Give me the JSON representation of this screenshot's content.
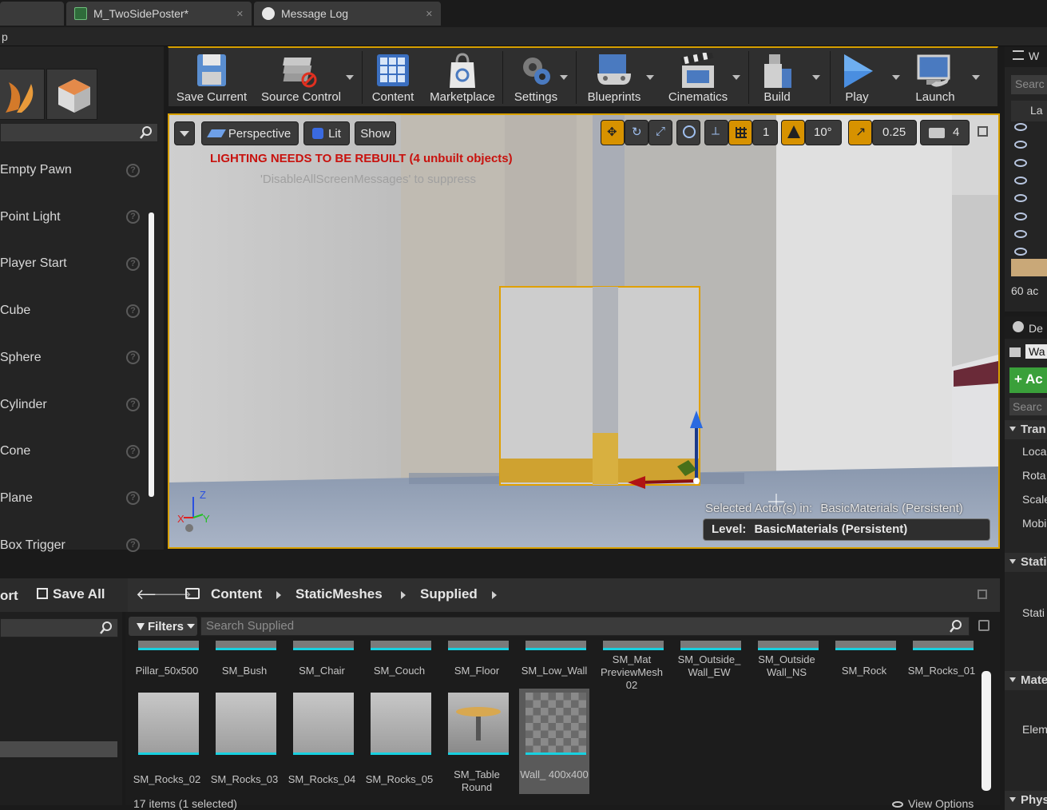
{
  "tabs": [
    {
      "label": "M_TwoSidePoster*"
    },
    {
      "label": "Message Log"
    }
  ],
  "menu": {
    "partial_label": "p"
  },
  "modes": {
    "place_items": [
      {
        "label": "Empty Pawn"
      },
      {
        "label": "Point Light"
      },
      {
        "label": "Player Start"
      },
      {
        "label": "Cube"
      },
      {
        "label": "Sphere"
      },
      {
        "label": "Cylinder"
      },
      {
        "label": "Cone"
      },
      {
        "label": "Plane"
      },
      {
        "label": "Box Trigger"
      }
    ],
    "help_glyph": "?"
  },
  "toolbar": {
    "save_current": "Save Current",
    "source_control": "Source Control",
    "content": "Content",
    "marketplace": "Marketplace",
    "settings": "Settings",
    "blueprints": "Blueprints",
    "cinematics": "Cinematics",
    "build": "Build",
    "play": "Play",
    "launch": "Launch"
  },
  "viewport": {
    "perspective": "Perspective",
    "lit": "Lit",
    "show": "Show",
    "grid_size": "1",
    "rotation_snap": "10°",
    "scale_snap": "0.25",
    "camera_speed": "4",
    "warning": "LIGHTING NEEDS TO BE REBUILT (4 unbuilt objects)",
    "warning_sub": "'DisableAllScreenMessages' to suppress",
    "selected_actor_label": "Selected Actor(s) in:",
    "selected_actor_level": "BasicMaterials (Persistent)",
    "level_label": "Level:",
    "level_value": "BasicMaterials (Persistent)",
    "axis_z": "Z",
    "axis_x": "X",
    "axis_y": "Y"
  },
  "world_outliner": {
    "title_partial": "W",
    "search_partial": "Searc",
    "column_partial": "La",
    "count_partial": "60 ac"
  },
  "details": {
    "title_partial": "De",
    "name_partial": "Wa",
    "add_partial": "+ Ac",
    "search_partial": "Searc",
    "sections": [
      {
        "label": "Tran"
      },
      {
        "label": "Stati"
      },
      {
        "label": "Mate"
      },
      {
        "label": "Phys"
      }
    ],
    "props": [
      {
        "label": "Loca"
      },
      {
        "label": "Rota"
      },
      {
        "label": "Scale"
      },
      {
        "label": "Mobi"
      },
      {
        "label": "Stati"
      },
      {
        "label": "Elem"
      }
    ]
  },
  "content_browser": {
    "import_partial": "ort",
    "save_all": "Save All",
    "breadcrumb": [
      "Content",
      "StaticMeshes",
      "Supplied"
    ],
    "filters": "Filters",
    "search_placeholder": "Search Supplied",
    "assets_row1": [
      {
        "label": "Pillar_50x500"
      },
      {
        "label": "SM_Bush"
      },
      {
        "label": "SM_Chair"
      },
      {
        "label": "SM_Couch"
      },
      {
        "label": "SM_Floor"
      },
      {
        "label": "SM_Low_Wall"
      },
      {
        "label": "SM_Mat PreviewMesh 02"
      },
      {
        "label": "SM_Outside_ Wall_EW"
      },
      {
        "label": "SM_Outside Wall_NS"
      },
      {
        "label": "SM_Rock"
      },
      {
        "label": "SM_Rocks_01"
      }
    ],
    "assets_row2": [
      {
        "label": "SM_Rocks_02"
      },
      {
        "label": "SM_Rocks_03"
      },
      {
        "label": "SM_Rocks_04"
      },
      {
        "label": "SM_Rocks_05"
      },
      {
        "label": "SM_Table Round"
      },
      {
        "label": "Wall_ 400x400"
      }
    ],
    "status": "17 items (1 selected)",
    "view_options": "View Options"
  },
  "colors": {
    "accent": "#d8a000",
    "warning": "#c8120e",
    "asset_underline": "#18d0e0"
  }
}
